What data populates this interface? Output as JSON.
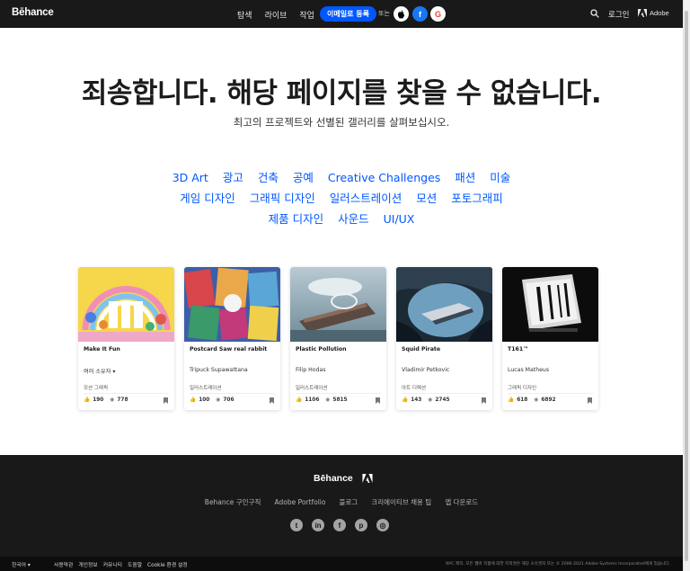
{
  "header": {
    "logo": "Bēhance",
    "nav": [
      "탐색",
      "라이브",
      "작업"
    ],
    "signup_label": "이메일로 등록",
    "or_label": "또는",
    "social": {
      "apple": "",
      "facebook": "f",
      "google": "G"
    },
    "login_label": "로그인",
    "adobe_label": "Adobe"
  },
  "hero": {
    "title": "죄송합니다. 해당 페이지를 찾을 수 없습니다.",
    "subtitle": "최고의 프로젝트와 선별된 갤러리를 살펴보십시오."
  },
  "categories": [
    "3D Art",
    "광고",
    "건축",
    "공예",
    "Creative Challenges",
    "패션",
    "미술",
    "게임 디자인",
    "그래픽 디자인",
    "일러스트레이션",
    "모션",
    "포토그래피",
    "제품 디자인",
    "사운드",
    "UI/UX"
  ],
  "projects": [
    {
      "title": "Make It Fun",
      "owner": "여러 소유자",
      "field": "모션 그래픽",
      "likes": "190",
      "views": "778"
    },
    {
      "title": "Postcard Saw real rabbit",
      "owner": "Tripuck Supawattana",
      "field": "일러스트레이션",
      "likes": "100",
      "views": "706"
    },
    {
      "title": "Plastic Pollution",
      "owner": "Filip Hodas",
      "field": "일러스트레이션",
      "likes": "1106",
      "views": "5815"
    },
    {
      "title": "Squid Pirate",
      "owner": "Vladimir Petkovic",
      "field": "아트 디렉션",
      "likes": "143",
      "views": "2745"
    },
    {
      "title": "T161™",
      "owner": "Lucas Matheus",
      "field": "그래픽 디자인",
      "likes": "618",
      "views": "6892"
    }
  ],
  "footer": {
    "logo": "Bēhance",
    "links": [
      "Behance 구인구직",
      "Adobe Portfolio",
      "블로그",
      "크리에이티브 채용 팁",
      "앱 다운로드"
    ],
    "social": [
      "twitter",
      "linkedin",
      "facebook",
      "pinterest",
      "instagram"
    ],
    "social_glyphs": [
      "t",
      "in",
      "f",
      "p",
      "◎"
    ],
    "language": "한국어",
    "bottom_links": [
      "사용약관",
      "개인정보",
      "커뮤니티",
      "도움말",
      "Cookie 환경 설정"
    ],
    "legal": "NYC 제작. 모든 웹버 작품에 대한 지적권은 해당 소유권자 또는 © 2006-2021 Adobe Systems Incorporated에게 있습니다."
  },
  "colors": {
    "accent": "#0057ff",
    "header_bg": "#191919",
    "footer_bg": "#191919"
  }
}
